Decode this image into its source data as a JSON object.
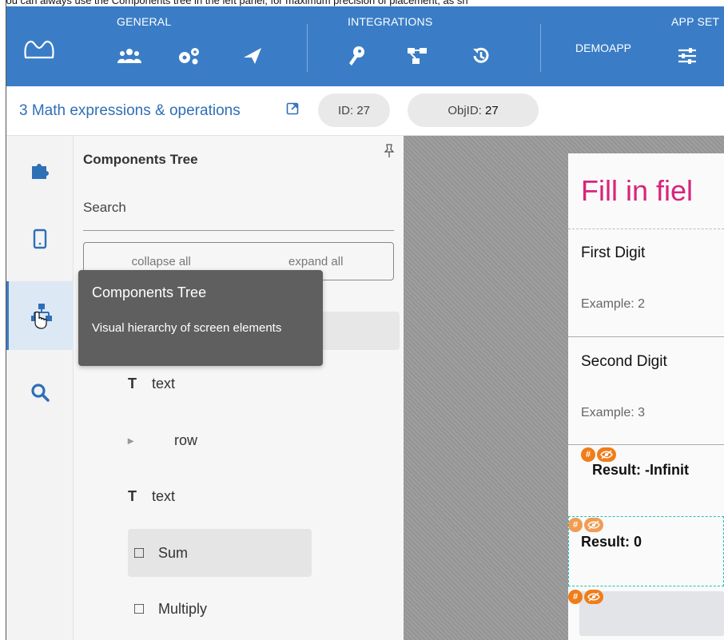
{
  "caption": "You can always use the Components tree in the left panel, for maximum precision of placement, as sh",
  "topbar": {
    "groups": [
      {
        "title": "GENERAL"
      },
      {
        "title": "INTEGRATIONS"
      },
      {
        "title": "APP SET"
      }
    ],
    "app_name": "DEMOAPP",
    "icons": [
      "users-icon",
      "gears-icon",
      "send-icon",
      "key-icon",
      "flow-icon",
      "history-icon",
      "sliders-icon"
    ]
  },
  "subheader": {
    "screen_title": "3 Math expressions & operations",
    "id_label": "ID: 27",
    "objid_label": "ObjID:",
    "objid_value": "27"
  },
  "panel": {
    "title": "Components Tree",
    "search_label": "Search",
    "collapse_all": "collapse all",
    "expand_all": "expand all",
    "tree": [
      {
        "icon": "T",
        "label": "text"
      },
      {
        "icon": "▸",
        "label": "row"
      },
      {
        "icon": "T",
        "label": "text"
      },
      {
        "icon": "□",
        "label": "Sum"
      },
      {
        "icon": "□",
        "label": "Multiply"
      }
    ]
  },
  "tooltip": {
    "title": "Components Tree",
    "description": "Visual hierarchy of screen elements"
  },
  "device": {
    "title": "Fill in fiel",
    "first_label": "First Digit",
    "first_hint": "Example: 2",
    "second_label": "Second Digit",
    "second_hint": "Example: 3",
    "result1": "Result: -Infinit",
    "result2": "Result: 0",
    "badge_hash": "#"
  },
  "colors": {
    "topbar": "#3a7dc6",
    "title_pink": "#d8247c",
    "badge_orange": "#ef7d1a",
    "selection_teal": "#20c2b0"
  }
}
